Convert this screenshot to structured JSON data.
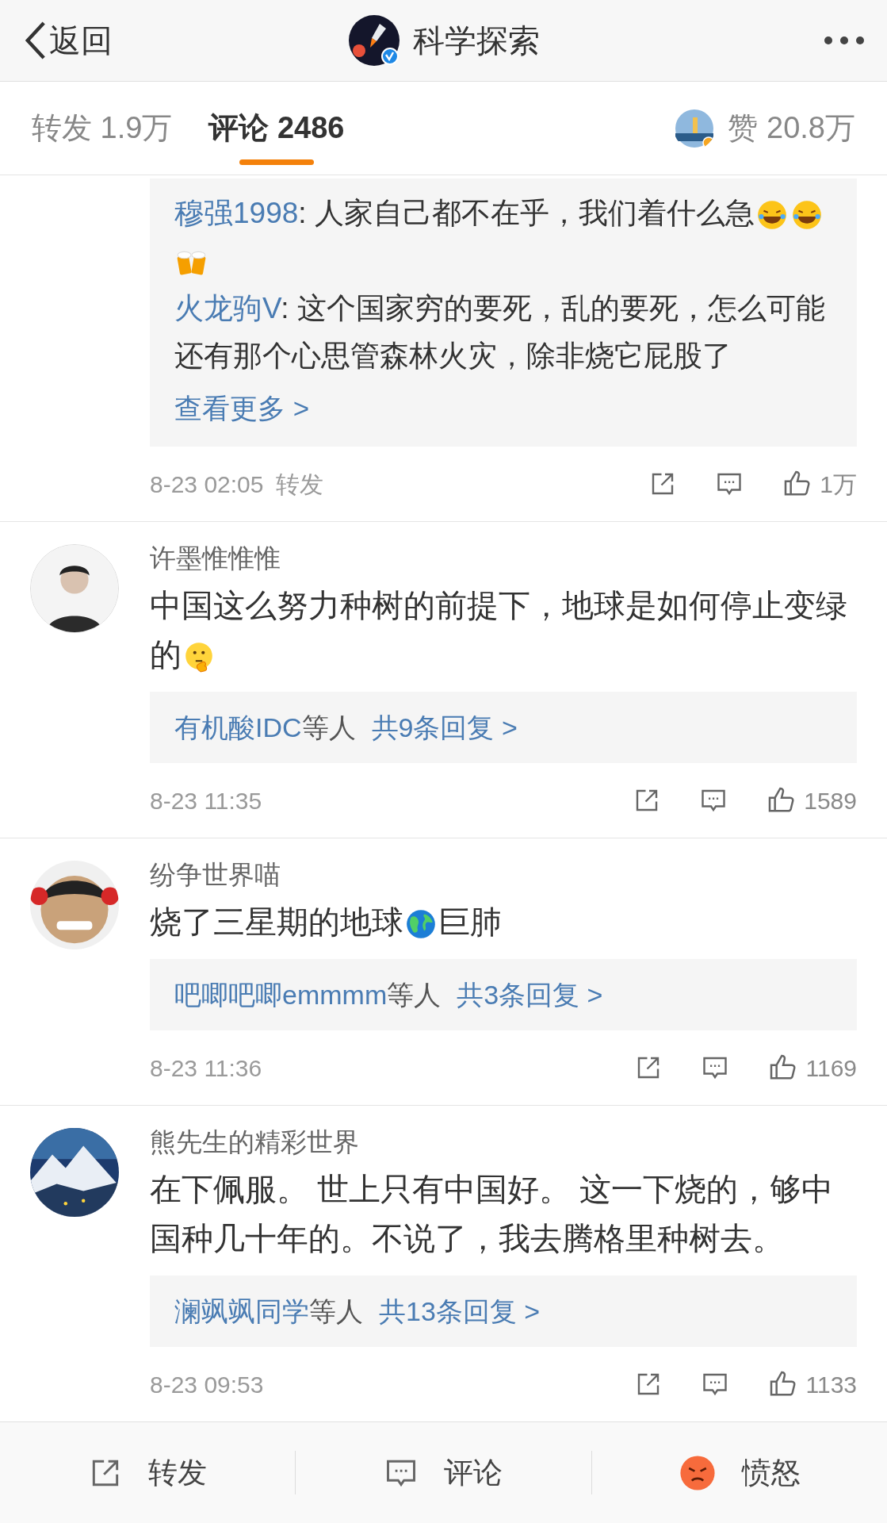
{
  "header": {
    "back_label": "返回",
    "title": "科学探索"
  },
  "tabs": [
    {
      "label": "转发",
      "count": "1.9万",
      "selected": false
    },
    {
      "label": "评论",
      "count": "2486",
      "selected": true
    }
  ],
  "likes_tab": {
    "label": "赞",
    "count": "20.8万"
  },
  "comments": [
    {
      "kind": "partial",
      "replies": [
        {
          "user": "穆强1998",
          "segments": [
            {
              "kind": "text",
              "text": ": 人家自己都不在乎，我们着什么急"
            },
            {
              "kind": "laugh"
            },
            {
              "kind": "laugh"
            },
            {
              "kind": "beer"
            }
          ]
        },
        {
          "user": "火龙驹V",
          "segments": [
            {
              "kind": "text",
              "text": ": 这个国家穷的要死，乱的要死，怎么可能还有那个心思管森林火灾，除非烧它屁股了"
            }
          ]
        }
      ],
      "more": "查看更多 >",
      "time": "8-23 02:05",
      "extra": "转发",
      "likes": "1万"
    },
    {
      "kind": "full",
      "avatar": {
        "kind": "dark"
      },
      "name": "许墨惟惟惟",
      "segments": [
        {
          "kind": "text",
          "text": "中国这么努力种树的前提下，地球是如何停止变绿的"
        },
        {
          "kind": "think"
        }
      ],
      "summary": {
        "user": "有机酸IDC",
        "suffix": "等人",
        "link": "共9条回复 >"
      },
      "time": "8-23 11:35",
      "likes": "1589"
    },
    {
      "kind": "full",
      "avatar": {
        "kind": "cartoon"
      },
      "name": "纷争世界喵",
      "segments": [
        {
          "kind": "text",
          "text": "烧了三星期的地球"
        },
        {
          "kind": "globe"
        },
        {
          "kind": "text",
          "text": "巨肺"
        }
      ],
      "summary": {
        "user": "吧唧吧唧emmmm",
        "suffix": "等人",
        "link": "共3条回复 >"
      },
      "time": "8-23 11:36",
      "likes": "1169"
    },
    {
      "kind": "full",
      "avatar": {
        "kind": "mountain"
      },
      "name": "熊先生的精彩世界",
      "segments": [
        {
          "kind": "text",
          "text": "在下佩服。 世上只有中国好。 这一下烧的，够中国种几十年的。不说了，我去腾格里种树去。"
        }
      ],
      "summary": {
        "user": "澜飒飒同学",
        "suffix": "等人",
        "link": "共13条回复 >"
      },
      "time": "8-23 09:53",
      "likes": "1133"
    }
  ],
  "bottom_bar": [
    {
      "kind": "share",
      "label": "转发"
    },
    {
      "kind": "comment",
      "label": "评论"
    },
    {
      "kind": "angry",
      "label": "愤怒"
    }
  ]
}
